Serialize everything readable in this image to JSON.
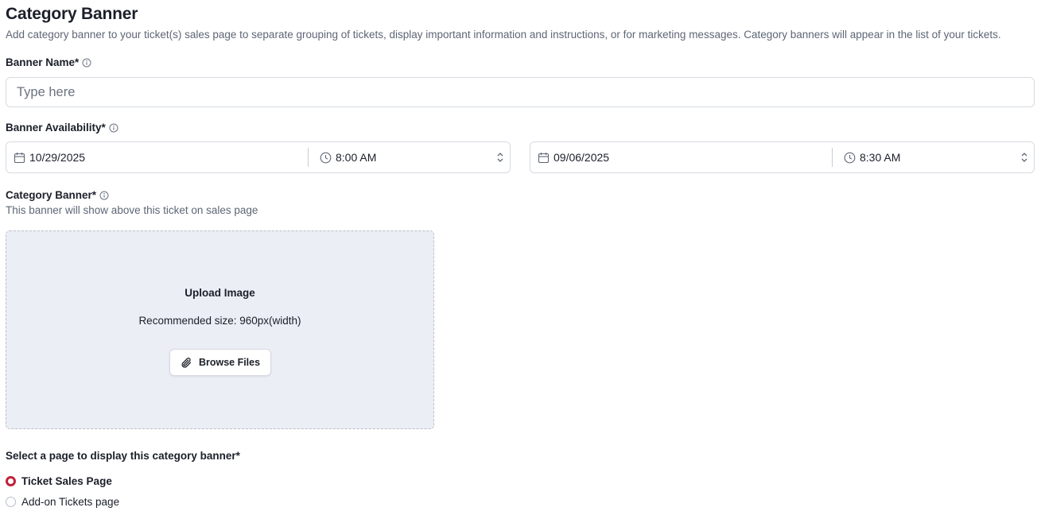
{
  "header": {
    "title": "Category Banner",
    "description": "Add category banner to your ticket(s) sales page to separate grouping of tickets, display important information and instructions, or for marketing messages. Category banners will appear in the list of your tickets."
  },
  "banner_name": {
    "label": "Banner Name*",
    "placeholder": "Type here",
    "value": ""
  },
  "availability": {
    "label": "Banner Availability*",
    "start": {
      "date": "10/29/2025",
      "time": "8:00 AM"
    },
    "end": {
      "date": "09/06/2025",
      "time": "8:30 AM"
    }
  },
  "category_banner": {
    "label": "Category Banner*",
    "description": "This banner will show above this ticket on sales page",
    "upload": {
      "title": "Upload Image",
      "hint": "Recommended size: 960px(width)",
      "button_label": "Browse Files"
    }
  },
  "display_page": {
    "label": "Select a page to display this category banner*",
    "options": [
      {
        "label": "Ticket Sales Page",
        "selected": true
      },
      {
        "label": "Add-on Tickets page",
        "selected": false
      }
    ]
  },
  "colors": {
    "accent": "#c0223b",
    "upload_bg": "#ebeef4",
    "muted_text": "#5d6676"
  },
  "icons": {
    "info": "info-icon",
    "calendar": "calendar-icon",
    "clock": "clock-icon",
    "stepper": "chevron-up-down-icon",
    "paperclip": "paperclip-icon"
  }
}
